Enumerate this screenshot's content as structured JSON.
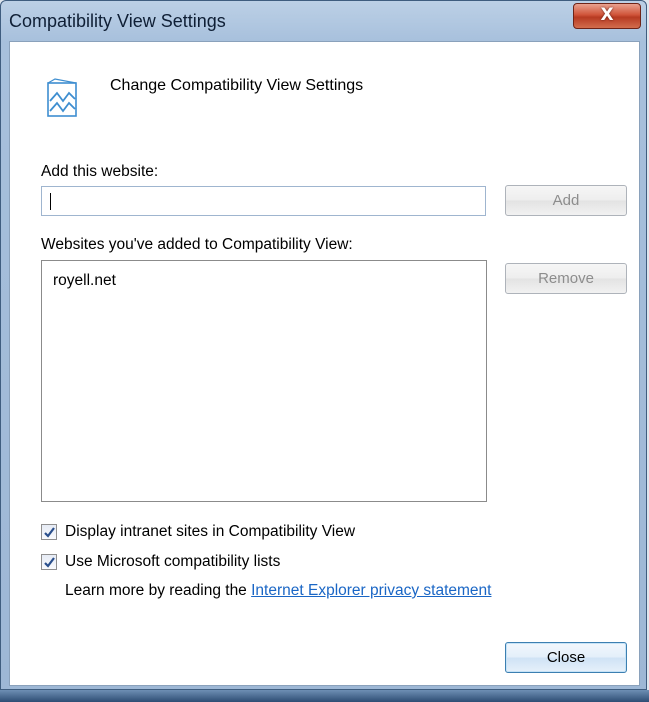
{
  "window": {
    "title": "Compatibility View Settings",
    "close_glyph": "X"
  },
  "header": {
    "text": "Change Compatibility View Settings",
    "icon": "compatibility-view-icon"
  },
  "add_section": {
    "label": "Add this website:",
    "input_value": "",
    "add_label": "Add"
  },
  "list_section": {
    "label": "Websites you've added to Compatibility View:",
    "items": [
      "royell.net"
    ],
    "remove_label": "Remove"
  },
  "options": {
    "intranet": {
      "label": "Display intranet sites in Compatibility View",
      "checked": true
    },
    "ms_lists": {
      "label": "Use Microsoft compatibility lists",
      "checked": true
    }
  },
  "learn_more": {
    "prefix": "Learn more by reading the ",
    "link": "Internet Explorer privacy statement"
  },
  "footer": {
    "close_label": "Close"
  },
  "colors": {
    "link": "#1a66c5",
    "close_x": "#c8452c",
    "checkmark": "#2a4f8c"
  }
}
